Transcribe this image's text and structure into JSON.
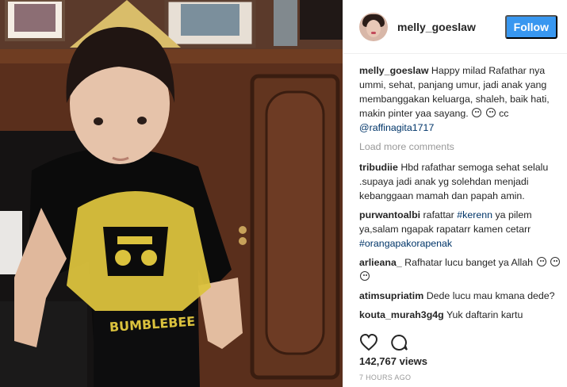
{
  "post": {
    "author": "melly_goeslaw",
    "follow_label": "Follow",
    "views": "142,767 views",
    "timestamp": "7 HOURS AGO"
  },
  "caption": {
    "author": "melly_goeslaw",
    "text": " Happy milad Rafathar nya ummi, sehat, panjang umur, jadi anak yang membanggakan keluarga, shaleh, baik hati, makin pinter yaa sayang. ",
    "cc": " cc ",
    "mention": "@raffinagita1717"
  },
  "load_more": "Load more comments",
  "comments": [
    {
      "user": "tribudiie",
      "text": " Hbd rafathar semoga sehat selalu .supaya jadi anak yg solehdan menjadi kebanggaan mamah dan papah amin."
    },
    {
      "user": "purwantoalbi",
      "text_a": " rafattar ",
      "tag1": "#kerenn",
      "text_b": " ya pilem ya,salam ngapak rapatarr kamen cetarr ",
      "tag2": "#orangapakorapenak"
    },
    {
      "user": "arlieana_",
      "text": " Rafhatar lucu banget ya Allah "
    },
    {
      "user": "atimsupriatim",
      "text": " Dede lucu mau kmana dede?"
    },
    {
      "user": "kouta_murah3g4g",
      "text": " Yuk daftarin kartu"
    }
  ],
  "colors": {
    "follow_bg": "#3897f0",
    "link": "#003569",
    "muted": "#999999"
  },
  "icons": [
    "heart-icon",
    "comment-icon"
  ]
}
